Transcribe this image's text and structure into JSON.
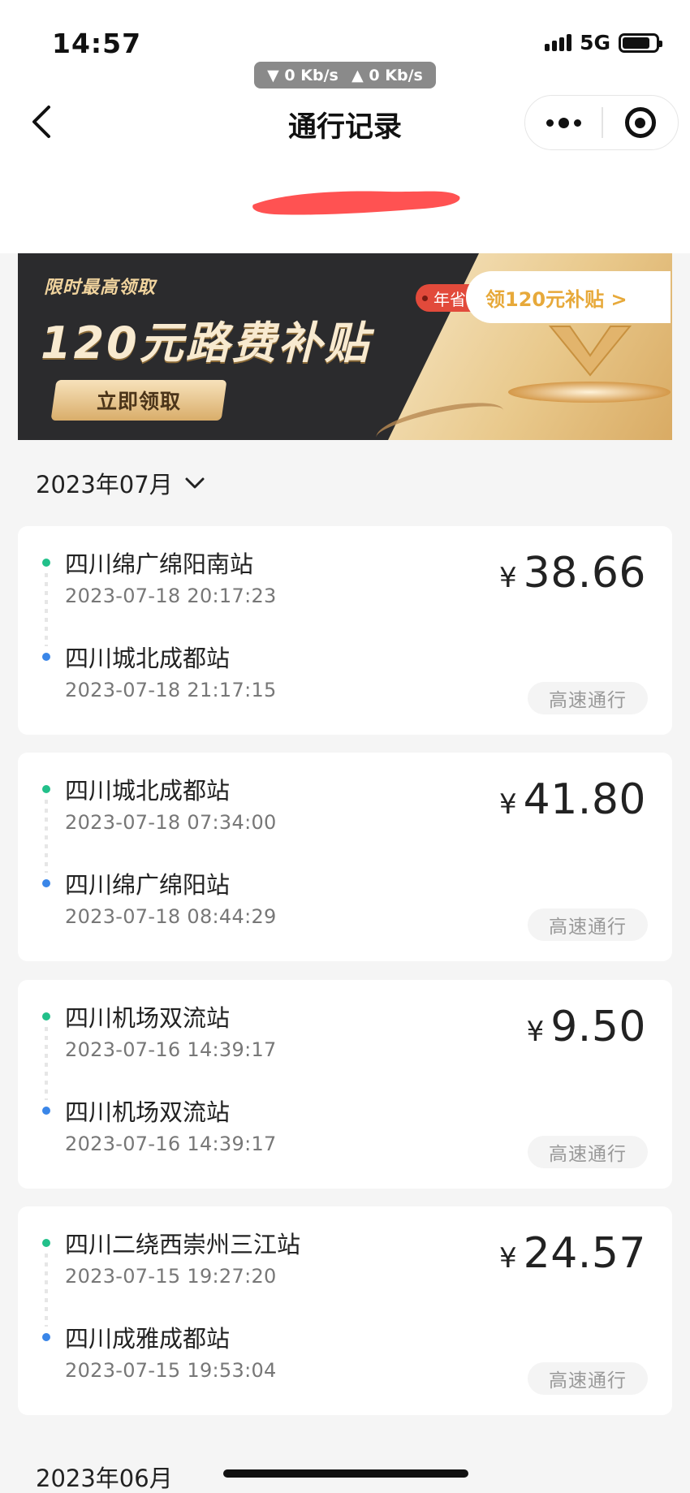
{
  "status_bar": {
    "time": "14:57",
    "network": "5G",
    "download_speed": "0 Kb/s",
    "upload_speed": "0 Kb/s"
  },
  "header": {
    "title": "通行记录"
  },
  "banner": {
    "small_text": "限时最高领取",
    "big_text": "120元路费补贴",
    "cta_label": "立即领取",
    "tag_text": "年省",
    "claim_label": "领120元补贴 >"
  },
  "month_selector": {
    "current": "2023年07月"
  },
  "records": [
    {
      "start_station": "四川绵广绵阳南站",
      "start_time": "2023-07-18 20:17:23",
      "end_station": "四川城北成都站",
      "end_time": "2023-07-18 21:17:15",
      "currency": "¥",
      "amount": "38.66",
      "badge": "高速通行"
    },
    {
      "start_station": "四川城北成都站",
      "start_time": "2023-07-18 07:34:00",
      "end_station": "四川绵广绵阳站",
      "end_time": "2023-07-18 08:44:29",
      "currency": "¥",
      "amount": "41.80",
      "badge": "高速通行"
    },
    {
      "start_station": "四川机场双流站",
      "start_time": "2023-07-16 14:39:17",
      "end_station": "四川机场双流站",
      "end_time": "2023-07-16 14:39:17",
      "currency": "¥",
      "amount": "9.50",
      "badge": "高速通行"
    },
    {
      "start_station": "四川二绕西崇州三江站",
      "start_time": "2023-07-15 19:27:20",
      "end_station": "四川成雅成都站",
      "end_time": "2023-07-15 19:53:04",
      "currency": "¥",
      "amount": "24.57",
      "badge": "高速通行"
    }
  ],
  "next_month": "2023年06月",
  "colors": {
    "start_dot": "#22c08a",
    "end_dot": "#3a86e8",
    "banner_dark": "#2b2b2d",
    "banner_gold": "#e9c98c",
    "tag_red": "#e24a3b",
    "claim_text": "#e7a93a"
  },
  "icons": {
    "back": "chevron-left-icon",
    "more": "more-dots-icon",
    "close_miniprogram": "target-icon",
    "month_dropdown": "chevron-down-icon"
  }
}
